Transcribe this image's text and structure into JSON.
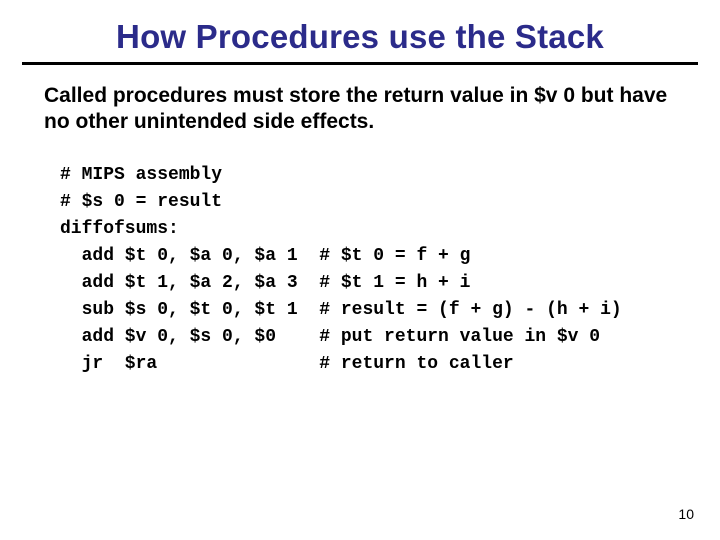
{
  "title": "How Procedures use the Stack",
  "body": "Called procedures must store the return value in $v 0 but have no other unintended side effects.",
  "code": "# MIPS assembly\n# $s 0 = result\ndiffofsums:\n  add $t 0, $a 0, $a 1  # $t 0 = f + g\n  add $t 1, $a 2, $a 3  # $t 1 = h + i\n  sub $s 0, $t 0, $t 1  # result = (f + g) - (h + i)\n  add $v 0, $s 0, $0    # put return value in $v 0\n  jr  $ra               # return to caller",
  "page_number": "10"
}
